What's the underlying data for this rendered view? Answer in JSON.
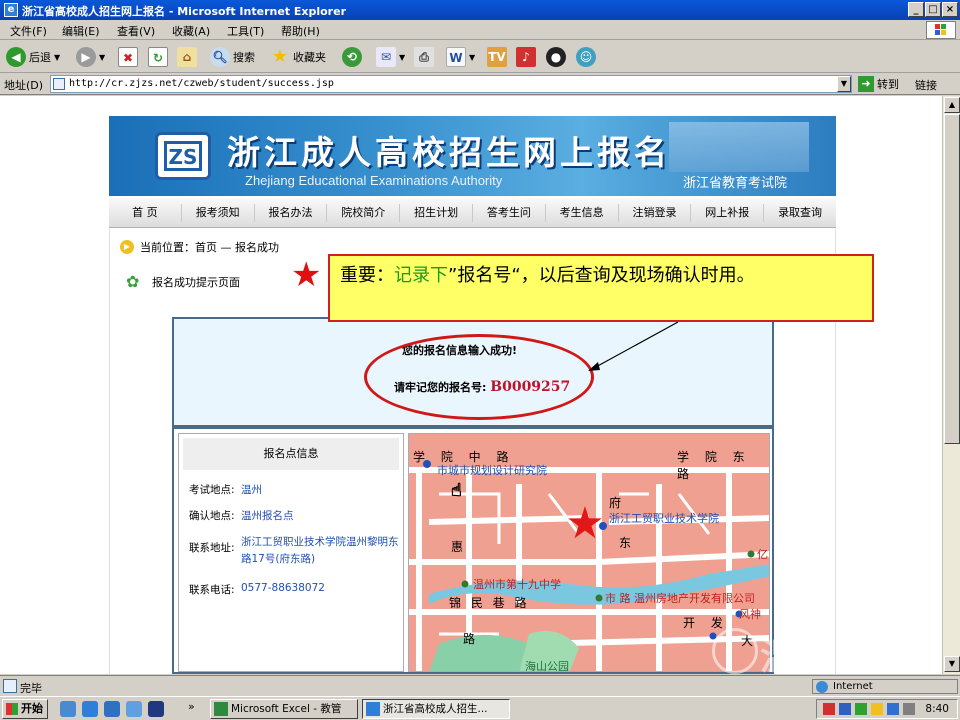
{
  "window": {
    "title": "浙江省高校成人招生网上报名 - Microsoft Internet Explorer",
    "buttons": [
      "_",
      "□",
      "×"
    ]
  },
  "menubar": {
    "items": [
      "文件(F)",
      "编辑(E)",
      "查看(V)",
      "收藏(A)",
      "工具(T)",
      "帮助(H)"
    ]
  },
  "toolbar": {
    "back_label": "后退",
    "search_label": "搜索",
    "favorites_label": "收藏夹"
  },
  "addressbar": {
    "label": "地址(D)",
    "url": "http://cr.zjzs.net/czweb/student/success.jsp",
    "go_label": "转到",
    "links_label": "链接"
  },
  "banner": {
    "title": "浙江成人高校招生网上报名",
    "subtitle_en": "Zhejiang Educational Examinations Authority",
    "org": "浙江省教育考试院",
    "logo_text": "ZS"
  },
  "nav": {
    "items": [
      "首 页",
      "报考须知",
      "报名办法",
      "院校简介",
      "招生计划",
      "答考生问",
      "考生信息",
      "注销登录",
      "网上补报",
      "录取查询"
    ]
  },
  "page": {
    "location": "当前位置：首页 — 报名成功",
    "success_title": "报名成功提示页面",
    "message_line1": "您的报名信息输入成功!",
    "message_line2_prefix": "请牢记您的报名号:",
    "registration_number": "B0009257"
  },
  "info": {
    "header": "报名点信息",
    "rows": [
      {
        "label": "考试地点:",
        "value": "温州"
      },
      {
        "label": "确认地点:",
        "value": "温州报名点"
      },
      {
        "label": "联系地址:",
        "value": "浙江工贸职业技术学院温州黎明东路17号(府东路)"
      },
      {
        "label": "联系电话:",
        "value": "0577-88638072"
      }
    ]
  },
  "map": {
    "labels": {
      "road_north": "学 院 中 路",
      "road_north_east": "学 院 东 路",
      "institute": "市城市规划设计研究院",
      "college": "浙江工贸职业技术学院",
      "school": "温州市第十九中学",
      "estate": "市 路 温州房地产开发有限公司",
      "road_west": "锦 民 巷 路",
      "east": "东",
      "hui": "惠",
      "kaifa": "开 发",
      "lu": "路",
      "da": "大",
      "fengshen": "风神",
      "park": "海山公园",
      "fu": "府",
      "yi": "亿"
    }
  },
  "callout": {
    "prefix": "重要：",
    "highlight": "记录下",
    "rest": "”报名号“，以后查询及现场确认时用。"
  },
  "statusbar": {
    "text": "完毕",
    "zone": "Internet"
  },
  "taskbar": {
    "start_label": "开始",
    "tasks": [
      "Microsoft Excel - 教管",
      "浙江省高校成人招生..."
    ],
    "clock": "8:40",
    "chevron": "»"
  },
  "watermark": "温州大学",
  "colors": {
    "titlebar": "#0a58d8",
    "callout_bg": "#ffff66",
    "callout_border": "#d02020",
    "ellipse": "#d01818",
    "reg_number": "#c0102a",
    "map_bg": "#f0a090"
  }
}
